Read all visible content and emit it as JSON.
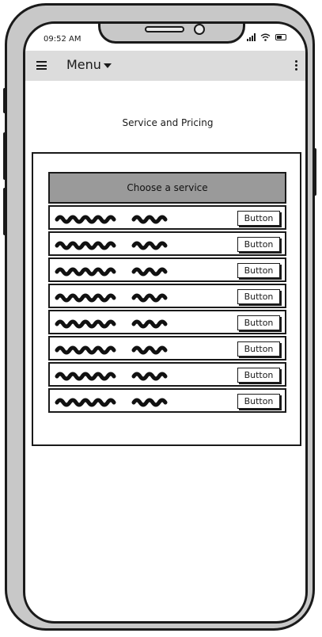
{
  "status_bar": {
    "time": "09:52 AM"
  },
  "menubar": {
    "menu_label": "Menu"
  },
  "page": {
    "title": "Service and Pricing"
  },
  "list": {
    "header": "Choose a service",
    "items": [
      {
        "button_label": "Button"
      },
      {
        "button_label": "Button"
      },
      {
        "button_label": "Button"
      },
      {
        "button_label": "Button"
      },
      {
        "button_label": "Button"
      },
      {
        "button_label": "Button"
      },
      {
        "button_label": "Button"
      },
      {
        "button_label": "Button"
      }
    ]
  }
}
